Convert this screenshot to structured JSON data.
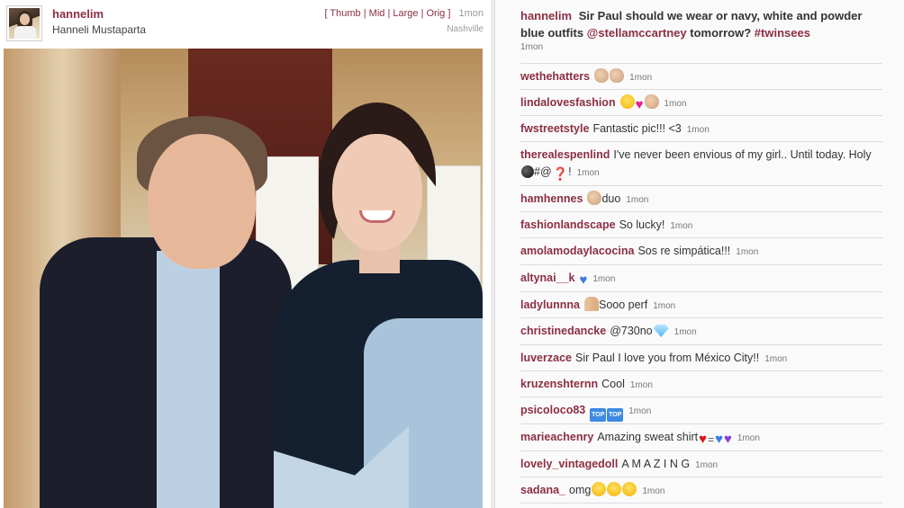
{
  "post": {
    "username": "hannelim",
    "fullname": "Hanneli Mustaparta",
    "sizes_prefix": "[",
    "size_links": [
      "Thumb",
      "Mid",
      "Large",
      "Orig"
    ],
    "sizes_suffix": "]",
    "time": "1mon",
    "location": "Nashville"
  },
  "caption": {
    "user": "hannelim",
    "text_before": "Sir Paul should we wear or navy, white and powder blue outfits",
    "mention": "@stellamccartney",
    "text_after": "tomorrow?",
    "hashtag": "#twinsees",
    "time": "1mon"
  },
  "comments": [
    {
      "user": "wethehatters",
      "text": "",
      "time": "1mon",
      "emojis": [
        "ok-hand-icon",
        "ok-hand-icon"
      ]
    },
    {
      "user": "lindalovesfashion",
      "text": "",
      "time": "1mon",
      "emojis": [
        "heart-eyes-icon",
        "heart-icon",
        "ok-hand-icon"
      ]
    },
    {
      "user": "fwstreetstyle",
      "text": "Fantastic pic!!! <3",
      "time": "1mon",
      "emojis": []
    },
    {
      "user": "therealespenlind",
      "text": "I've never been envious of my girl.. Until today. Holy",
      "text2": "#@",
      "text3": "!",
      "time": "1mon",
      "emojis": [
        "bomb-icon"
      ],
      "emojis2": [
        "question-mark-icon"
      ]
    },
    {
      "user": "hamhennes",
      "text": "duo",
      "time": "1mon",
      "emojis_before": [
        "ok-hand-icon"
      ]
    },
    {
      "user": "fashionlandscape",
      "text": "So lucky!",
      "time": "1mon",
      "emojis": []
    },
    {
      "user": "amolamodaylacocina",
      "text": "Sos re simpática!!!",
      "time": "1mon",
      "emojis": []
    },
    {
      "user": "altynai__k",
      "text": "",
      "time": "1mon",
      "emojis": [
        "blue-heart-icon"
      ]
    },
    {
      "user": "ladylunnna",
      "text": "Sooo perf",
      "time": "1mon",
      "emojis_before": [
        "praying-hands-icon"
      ]
    },
    {
      "user": "christinedancke",
      "text": "@730no",
      "time": "1mon",
      "emojis": [
        "diamond-icon"
      ]
    },
    {
      "user": "luverzace",
      "text": "Sir Paul I love you from México City!!",
      "time": "1mon",
      "emojis": []
    },
    {
      "user": "kruzenshternn",
      "text": "Cool",
      "time": "1mon",
      "emojis": []
    },
    {
      "user": "psicoloco83",
      "text": "",
      "time": "1mon",
      "emojis": [
        "top-icon",
        "top-icon"
      ]
    },
    {
      "user": "marieachenry",
      "text": "Amazing sweat shirt",
      "time": "1mon",
      "emojis": [
        "red-heart-icon",
        "equals-icon",
        "blue-heart-icon",
        "purple-heart-icon"
      ]
    },
    {
      "user": "lovely_vintagedoll",
      "text": "A M A Z I N G",
      "time": "1mon",
      "emojis": []
    },
    {
      "user": "sadana_",
      "text": "omg",
      "time": "1mon",
      "emojis": [
        "heart-eyes-icon",
        "heart-eyes-icon",
        "heart-eyes-icon"
      ]
    }
  ],
  "icons": {
    "top_label": "TOP"
  }
}
